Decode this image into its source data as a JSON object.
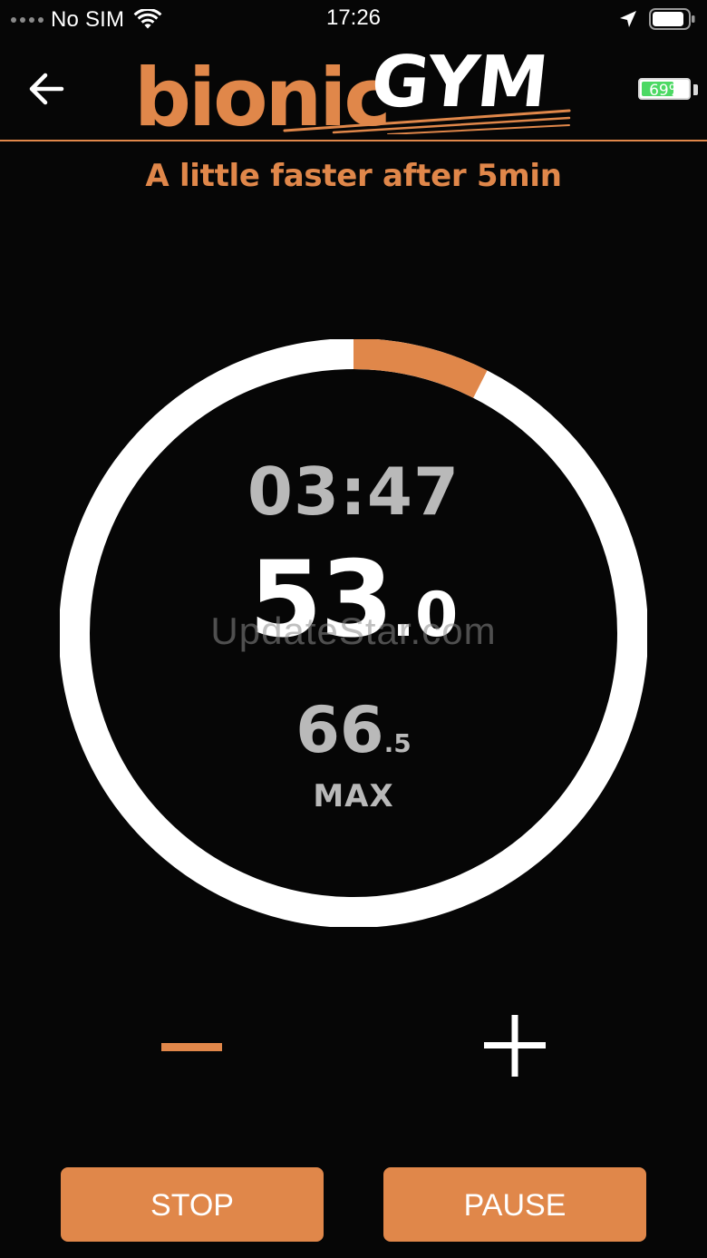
{
  "status_bar": {
    "carrier": "No SIM",
    "time": "17:26"
  },
  "header": {
    "logo_part1": "bionic",
    "logo_part2": "GYM",
    "battery_label": "69%",
    "battery_level": 0.69
  },
  "instruction": "A little faster after 5min",
  "dial": {
    "elapsed_time": "03:47",
    "current_whole": "53",
    "current_decimal": ".0",
    "max_whole": "66",
    "max_decimal": ".5",
    "max_label": "MAX",
    "progress_fraction": 0.075
  },
  "watermark": "UpdateStar.com",
  "controls": {
    "stop_label": "STOP",
    "pause_label": "PAUSE"
  },
  "icons": {
    "back": "back-arrow-icon",
    "minus": "minus-icon",
    "plus": "plus-icon",
    "wifi": "wifi-icon",
    "location": "location-arrow-icon",
    "battery": "battery-icon"
  },
  "colors": {
    "accent": "#e0874a",
    "background": "#060606",
    "ring": "#ffffff",
    "muted_text": "#b9b9b9",
    "battery_green": "#4cd964"
  }
}
